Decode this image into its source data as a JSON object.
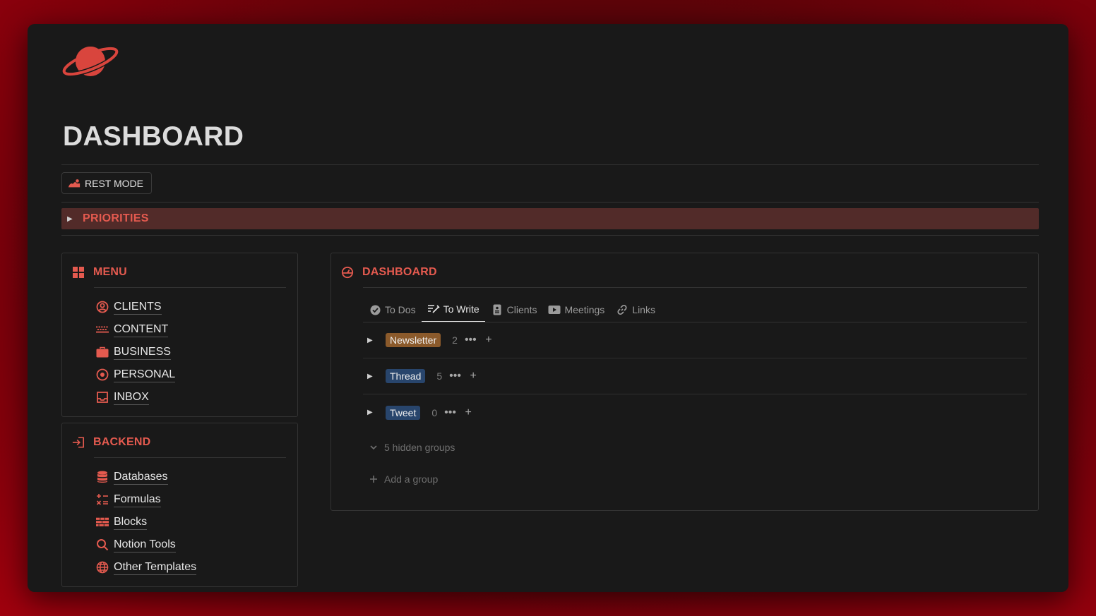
{
  "page": {
    "title": "DASHBOARD",
    "rest_mode_label": "REST MODE",
    "priorities_label": "PRIORITIES"
  },
  "menu": {
    "title": "MENU",
    "items": [
      {
        "label": "CLIENTS",
        "icon": "user-circle-icon"
      },
      {
        "label": "CONTENT",
        "icon": "keyboard-icon"
      },
      {
        "label": "BUSINESS",
        "icon": "briefcase-icon"
      },
      {
        "label": "PERSONAL",
        "icon": "target-icon"
      },
      {
        "label": "INBOX",
        "icon": "inbox-icon"
      }
    ]
  },
  "backend": {
    "title": "BACKEND",
    "items": [
      {
        "label": "Databases",
        "icon": "database-icon"
      },
      {
        "label": "Formulas",
        "icon": "formula-icon"
      },
      {
        "label": "Blocks",
        "icon": "blocks-icon"
      },
      {
        "label": "Notion Tools",
        "icon": "search-icon"
      },
      {
        "label": "Other Templates",
        "icon": "globe-icon"
      }
    ]
  },
  "dashboard": {
    "title": "DASHBOARD",
    "tabs": [
      {
        "label": "To Dos",
        "icon": "check-circle-icon",
        "active": false
      },
      {
        "label": "To Write",
        "icon": "write-icon",
        "active": true
      },
      {
        "label": "Clients",
        "icon": "id-card-icon",
        "active": false
      },
      {
        "label": "Meetings",
        "icon": "video-icon",
        "active": false
      },
      {
        "label": "Links",
        "icon": "link-icon",
        "active": false
      }
    ],
    "groups": [
      {
        "label": "Newsletter",
        "count": "2",
        "color": "#8b5a2b"
      },
      {
        "label": "Thread",
        "count": "5",
        "color": "#28456c"
      },
      {
        "label": "Tweet",
        "count": "0",
        "color": "#28456c"
      }
    ],
    "hidden_groups": "5 hidden groups",
    "add_group": "Add a group"
  },
  "colors": {
    "accent": "#e45a4f",
    "priorities_bg": "#522b29",
    "window_bg": "#191919"
  }
}
